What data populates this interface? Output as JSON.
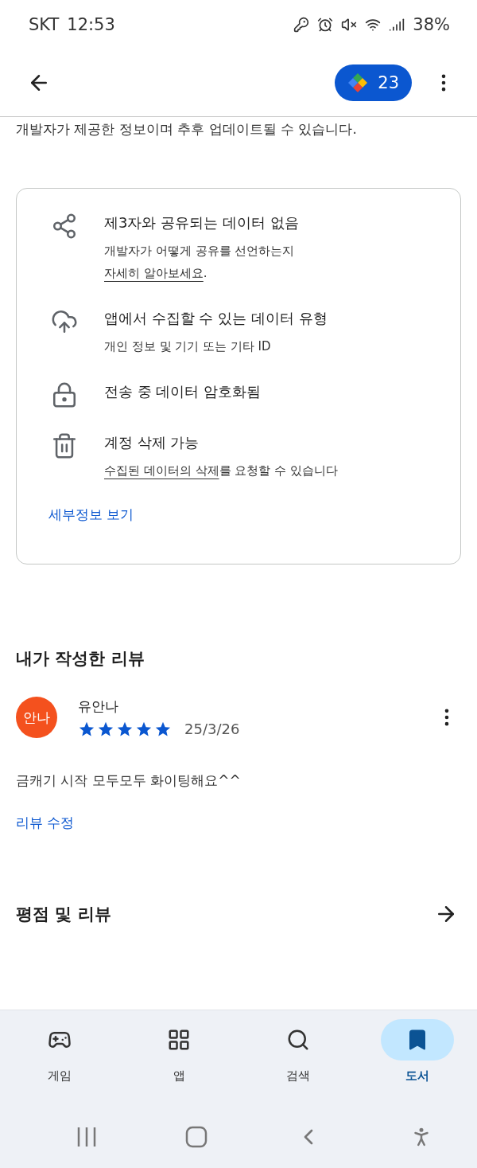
{
  "status_bar": {
    "carrier": "SKT",
    "time": "12:53",
    "battery": "38%"
  },
  "app_bar": {
    "points": "23"
  },
  "disclaimer": "개발자가 제공한 정보이며 추후 업데이트될 수 있습니다.",
  "safety_card": {
    "items": [
      {
        "kind": "share",
        "title": "제3자와 공유되는 데이터 없음",
        "detail_prefix": "개발자가 어떻게 공유를 선언하는지 ",
        "detail_link": "자세히 알아보세요",
        "detail_suffix": "."
      },
      {
        "kind": "upload",
        "title": "앱에서 수집할 수 있는 데이터 유형",
        "detail_prefix": "개인 정보 및 기기 또는 기타 ID"
      },
      {
        "kind": "lock",
        "title": "전송 중 데이터 암호화됨"
      },
      {
        "kind": "trash",
        "title": "계정 삭제 가능",
        "detail_link": "수집된 데이터의 삭제",
        "detail_suffix": "를 요청할 수 있습니다"
      }
    ],
    "details_link": "세부정보 보기"
  },
  "my_review": {
    "heading": "내가 작성한 리뷰",
    "avatar": "안나",
    "author": "유안나",
    "stars": 5,
    "date": "25/3/26",
    "text": "금캐기 시작 모두모두 화이팅해요^^",
    "edit_link": "리뷰 수정"
  },
  "ratings": {
    "heading": "평점 및 리뷰"
  },
  "bottom_nav": [
    {
      "kind": "games",
      "label": "게임",
      "selected": false
    },
    {
      "kind": "apps",
      "label": "앱",
      "selected": false
    },
    {
      "kind": "search",
      "label": "검색",
      "selected": false
    },
    {
      "kind": "books",
      "label": "도서",
      "selected": true
    }
  ]
}
